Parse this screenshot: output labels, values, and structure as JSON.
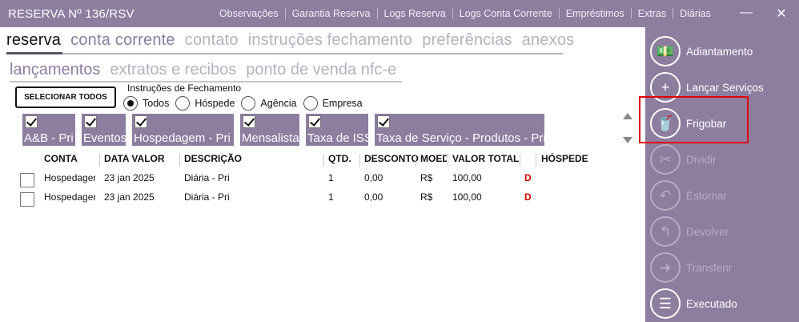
{
  "window": {
    "title": "RESERVA Nº 136/RSV",
    "menu": [
      "Observações",
      "Garantia Reserva",
      "Logs Reserva",
      "Logs Conta Corrente",
      "Empréstimos",
      "Extras",
      "Diárias"
    ],
    "minimize_glyph": "—",
    "close_glyph": "✕"
  },
  "tabs": {
    "primary": [
      "reserva",
      "conta corrente",
      "contato",
      "instruções fechamento",
      "preferências",
      "anexos"
    ],
    "secondary": [
      "lançamentos",
      "extratos e recibos",
      "ponto de venda nfc-e"
    ]
  },
  "select_all_label": "SELECIONAR TODOS",
  "instructions": {
    "label": "Instruções de Fechamento",
    "options": [
      "Todos",
      "Hóspede",
      "Agência",
      "Empresa"
    ],
    "selected": "Todos"
  },
  "filters": [
    {
      "label": "A&B - Pri",
      "checked": true
    },
    {
      "label": "Eventos",
      "checked": true
    },
    {
      "label": "Hospedagem - Pri",
      "checked": true
    },
    {
      "label": "Mensalista",
      "checked": true
    },
    {
      "label": "Taxa de ISS",
      "checked": true
    },
    {
      "label": "Taxa de Serviço - Produtos - Pri",
      "checked": true
    }
  ],
  "table": {
    "columns": [
      "CONTA",
      "DATA VALOR",
      "DESCRIÇÃO",
      "QTD.",
      "DESCONTO",
      "MOEDA",
      "VALOR TOTAL",
      "",
      "HÓSPEDE"
    ],
    "rows": [
      {
        "conta": "Hospedagem",
        "data": "23 jan 2025",
        "descricao": "Diária - Pri",
        "qtd": "1",
        "desconto": "0,00",
        "moeda": "R$",
        "valor": "100,00",
        "flag": "D",
        "hospede": ""
      },
      {
        "conta": "Hospedagem",
        "data": "23 jan 2025",
        "descricao": "Diária - Pri",
        "qtd": "1",
        "desconto": "0,00",
        "moeda": "R$",
        "valor": "100,00",
        "flag": "D",
        "hospede": ""
      }
    ]
  },
  "sidebar": {
    "items": [
      {
        "label": "Adiantamento",
        "icon": "money-icon",
        "glyph": "💵",
        "enabled": true
      },
      {
        "label": "Lançar Serviços",
        "icon": "add-services-icon",
        "glyph": "+",
        "enabled": true
      },
      {
        "label": "Frigobar",
        "icon": "minibar-icon",
        "glyph": "🥤",
        "enabled": true
      },
      {
        "label": "Dividir",
        "icon": "scissors-icon",
        "glyph": "✂",
        "enabled": false
      },
      {
        "label": "Estornar",
        "icon": "undo-icon",
        "glyph": "↶",
        "enabled": false
      },
      {
        "label": "Devolver",
        "icon": "return-icon",
        "glyph": "↰",
        "enabled": false
      },
      {
        "label": "Transferir",
        "icon": "arrow-right-icon",
        "glyph": "➜",
        "enabled": false
      },
      {
        "label": "Executado",
        "icon": "checklist-icon",
        "glyph": "☰",
        "enabled": true
      }
    ]
  },
  "colors": {
    "accent": "#8d7d9f",
    "highlight": "#e00000",
    "flag": "#d00000"
  }
}
